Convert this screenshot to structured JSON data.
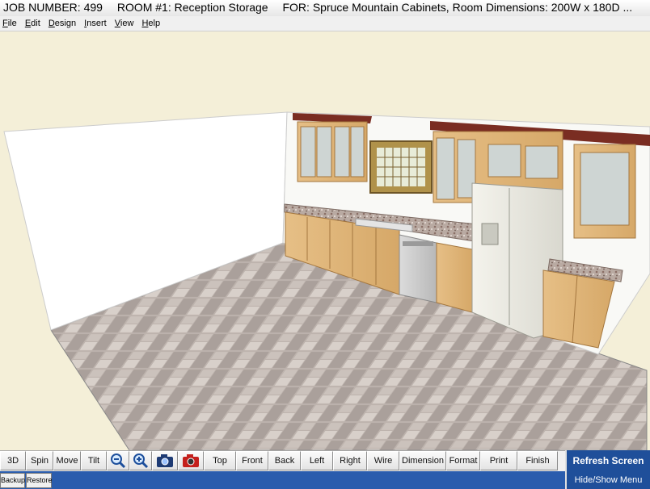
{
  "title": {
    "job": "JOB NUMBER: 499",
    "room": "ROOM #1: Reception Storage",
    "for": "FOR:  Spruce Mountain Cabinets,  Room Dimensions: 200W x 180D ..."
  },
  "menu": [
    "File",
    "Edit",
    "Design",
    "Insert",
    "View",
    "Help"
  ],
  "toolbar": {
    "3d": "3D",
    "spin": "Spin",
    "move": "Move",
    "tilt": "Tilt",
    "top": "Top",
    "front": "Front",
    "back": "Back",
    "left": "Left",
    "right": "Right",
    "wire": "Wire",
    "dimension": "Dimension",
    "format": "Format",
    "print": "Print",
    "finish": "Finish",
    "refresh": "Refresh Screen"
  },
  "bottom": {
    "backup": "Backup",
    "restore": "Restore",
    "hide_show": "Hide/Show Menu"
  },
  "icons": {
    "zoom_out": "zoom-out-icon",
    "zoom_in": "zoom-in-icon",
    "camera": "camera-icon",
    "camera_render": "camera-render-icon"
  },
  "colors": {
    "accent_bar": "#1f4f9a",
    "background": "#f4efd8"
  }
}
